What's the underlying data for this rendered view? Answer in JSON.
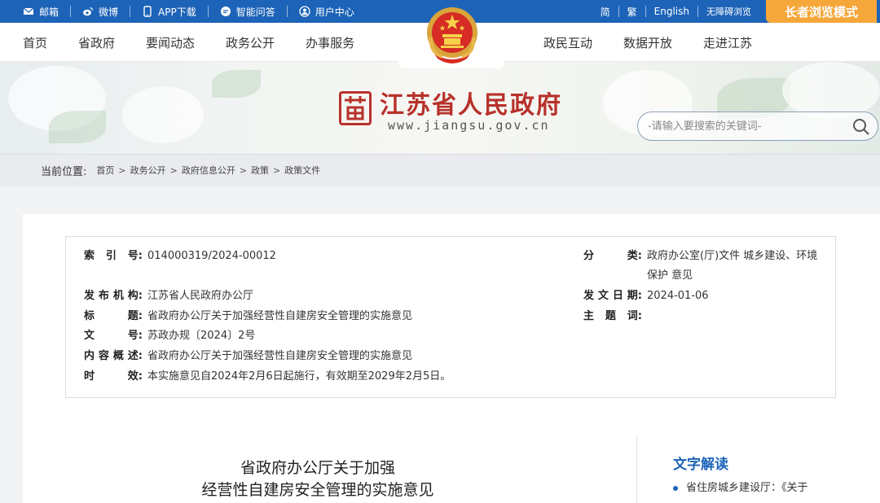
{
  "topbar": {
    "links": [
      {
        "label": "邮箱",
        "icon": "mail-icon"
      },
      {
        "label": "微博",
        "icon": "weibo-icon"
      },
      {
        "label": "APP下载",
        "icon": "phone-icon"
      },
      {
        "label": "智能问答",
        "icon": "chat-icon"
      },
      {
        "label": "用户中心",
        "icon": "user-icon"
      }
    ],
    "simplified": "简",
    "traditional": "繁",
    "english": "English",
    "accessible": "无障碍浏览",
    "elder_mode": "长者浏览模式"
  },
  "nav": {
    "left": [
      "首页",
      "省政府",
      "要闻动态",
      "政务公开",
      "办事服务"
    ],
    "right": [
      "政民互动",
      "数据开放",
      "走进江苏"
    ]
  },
  "header": {
    "site_name": "江苏省人民政府",
    "site_url": "www.jiangsu.gov.cn",
    "logo_glyph": "苏",
    "search_placeholder": "-请输入要搜索的关键词-"
  },
  "breadcrumb": {
    "label": "当前位置:",
    "items": [
      "首页",
      "政务公开",
      "政府信息公开",
      "政策",
      "政策文件"
    ]
  },
  "meta": {
    "index_label": [
      "索",
      "引",
      "号:"
    ],
    "index_value": "014000319/2024-00012",
    "category_label": [
      "分",
      "类:"
    ],
    "category_value_1": "政府办公室(厅)文件 城乡建设、环境",
    "category_value_2": "保护 意见",
    "issuer_label": [
      "发",
      "布",
      "机",
      "构:"
    ],
    "issuer_value": "江苏省人民政府办公厅",
    "date_label": [
      "发",
      "文",
      "日",
      "期:"
    ],
    "date_value": "2024-01-06",
    "title_label": [
      "标",
      "题:"
    ],
    "title_value": "省政府办公厅关于加强经营性自建房安全管理的实施意见",
    "subject_label": [
      "主",
      "题",
      "词:"
    ],
    "subject_value": "",
    "number_label": [
      "文",
      "号:"
    ],
    "number_value": "苏政办规〔2024〕2号",
    "summary_label": [
      "内",
      "容",
      "概",
      "述:"
    ],
    "summary_value": "省政府办公厅关于加强经营性自建房安全管理的实施意见",
    "effect_label": [
      "时",
      "效:"
    ],
    "effect_value": "本实施意见自2024年2月6日起施行，有效期至2029年2月5日。"
  },
  "document": {
    "title_line1": "省政府办公厅关于加强",
    "title_line2": "经营性自建房安全管理的实施意见"
  },
  "sidebar": {
    "title": "文字解读",
    "item": "省住房城乡建设厅：《关于"
  },
  "colors": {
    "brand_blue": "#1d63b8",
    "brand_red": "#b8312b",
    "elder_orange": "#f5a73a"
  }
}
